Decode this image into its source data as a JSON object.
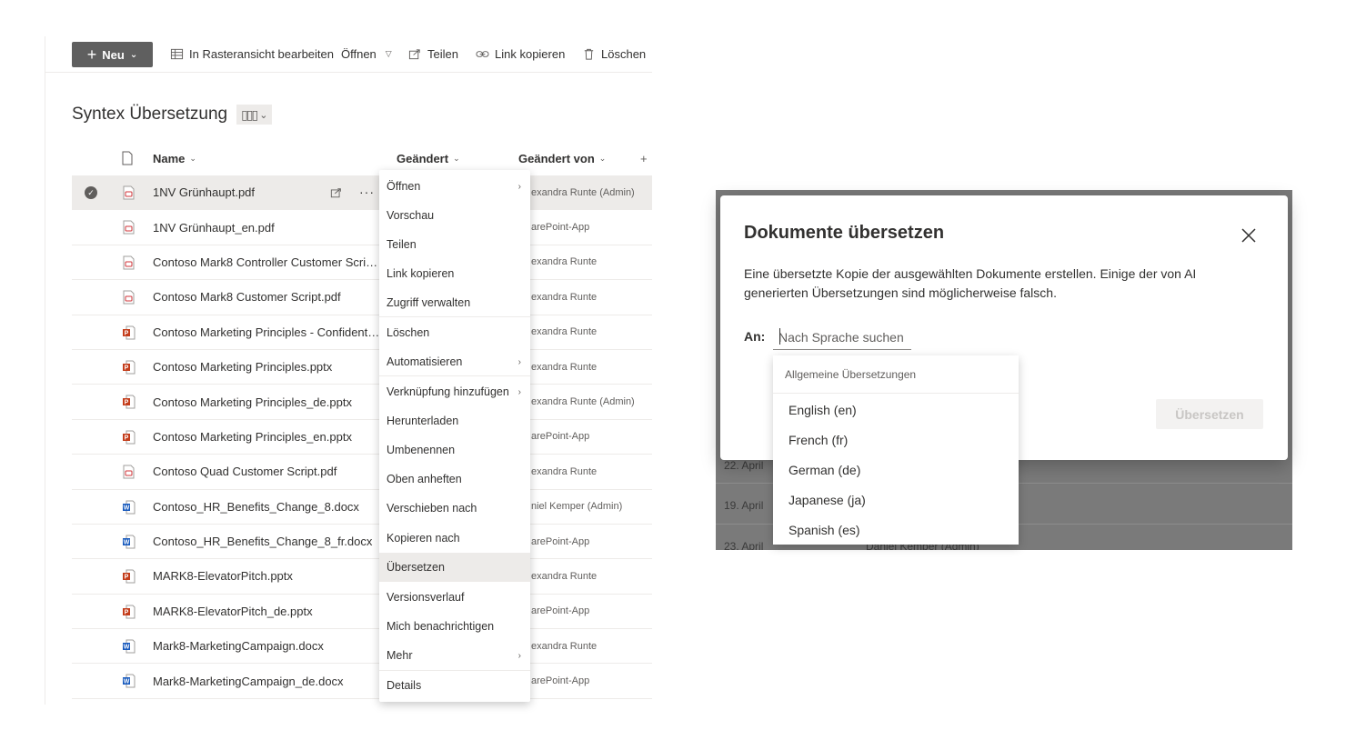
{
  "commandbar": {
    "new_label": "Neu",
    "grid_edit_label": "In Rasteransicht bearbeiten",
    "open_label": "Öffnen",
    "share_label": "Teilen",
    "copy_link_label": "Link kopieren",
    "delete_label": "Löschen"
  },
  "library": {
    "title": "Syntex Übersetzung"
  },
  "columns": {
    "name": "Name",
    "modified": "Geändert",
    "modified_by": "Geändert von",
    "add": "+"
  },
  "files": [
    {
      "name": "1NV Grünhaupt.pdf",
      "type": "pdf",
      "modified_by": "exandra Runte (Admin)",
      "selected": true
    },
    {
      "name": "1NV Grünhaupt_en.pdf",
      "type": "pdf",
      "modified_by": "arePoint-App"
    },
    {
      "name": "Contoso Mark8 Controller Customer Script ...",
      "type": "pdf",
      "modified_by": "exandra Runte"
    },
    {
      "name": "Contoso Mark8 Customer Script.pdf",
      "type": "pdf",
      "modified_by": "exandra Runte"
    },
    {
      "name": "Contoso Marketing Principles - Confidential...",
      "type": "pptx",
      "modified_by": "exandra Runte"
    },
    {
      "name": "Contoso Marketing Principles.pptx",
      "type": "pptx",
      "modified_by": "exandra Runte"
    },
    {
      "name": "Contoso Marketing Principles_de.pptx",
      "type": "pptx",
      "modified_by": "exandra Runte (Admin)"
    },
    {
      "name": "Contoso Marketing Principles_en.pptx",
      "type": "pptx",
      "modified_by": "arePoint-App"
    },
    {
      "name": "Contoso Quad Customer Script.pdf",
      "type": "pdf",
      "modified_by": "exandra Runte"
    },
    {
      "name": "Contoso_HR_Benefits_Change_8.docx",
      "type": "docx",
      "modified_by": "niel Kemper (Admin)"
    },
    {
      "name": "Contoso_HR_Benefits_Change_8_fr.docx",
      "type": "docx",
      "modified_by": "arePoint-App"
    },
    {
      "name": "MARK8-ElevatorPitch.pptx",
      "type": "pptx",
      "modified_by": "exandra Runte"
    },
    {
      "name": "MARK8-ElevatorPitch_de.pptx",
      "type": "pptx",
      "modified_by": "arePoint-App"
    },
    {
      "name": "Mark8-MarketingCampaign.docx",
      "type": "docx",
      "modified_by": "exandra Runte"
    },
    {
      "name": "Mark8-MarketingCampaign_de.docx",
      "type": "docx",
      "modified_by": "arePoint-App"
    }
  ],
  "context_menu": [
    {
      "label": "Öffnen",
      "submenu": true
    },
    {
      "label": "Vorschau"
    },
    {
      "label": "Teilen"
    },
    {
      "label": "Link kopieren"
    },
    {
      "label": "Zugriff verwalten"
    },
    {
      "label": "Löschen"
    },
    {
      "label": "Automatisieren",
      "submenu": true
    },
    {
      "label": "Verknüpfung hinzufügen",
      "submenu": true
    },
    {
      "label": "Herunterladen"
    },
    {
      "label": "Umbenennen"
    },
    {
      "label": "Oben anheften"
    },
    {
      "label": "Verschieben nach"
    },
    {
      "label": "Kopieren nach"
    },
    {
      "label": "Übersetzen",
      "highlighted": true
    },
    {
      "label": "Versionsverlauf"
    },
    {
      "label": "Mich benachrichtigen"
    },
    {
      "label": "Mehr",
      "submenu": true
    },
    {
      "label": "Details"
    }
  ],
  "background_rows": [
    {
      "date": "22. April",
      "user": ""
    },
    {
      "date": "19. April",
      "user": ""
    },
    {
      "date": "23. April",
      "user": "Daniel Kemper (Admin)"
    }
  ],
  "dialog": {
    "title": "Dokumente übersetzen",
    "description": "Eine übersetzte Kopie der ausgewählten Dokumente erstellen. Einige der von AI generierten Übersetzungen sind möglicherweise falsch.",
    "to_label": "An:",
    "search_placeholder": "Nach Sprache suchen",
    "translate_button": "Übersetzen"
  },
  "language_dropdown": {
    "header": "Allgemeine Übersetzungen",
    "options": [
      "English (en)",
      "French (fr)",
      "German (de)",
      "Japanese (ja)",
      "Spanish (es)"
    ]
  },
  "colors": {
    "pdf": "#d13438",
    "pptx": "#c43e1c",
    "docx": "#185abd",
    "accent_button": "#5f5f5f"
  }
}
